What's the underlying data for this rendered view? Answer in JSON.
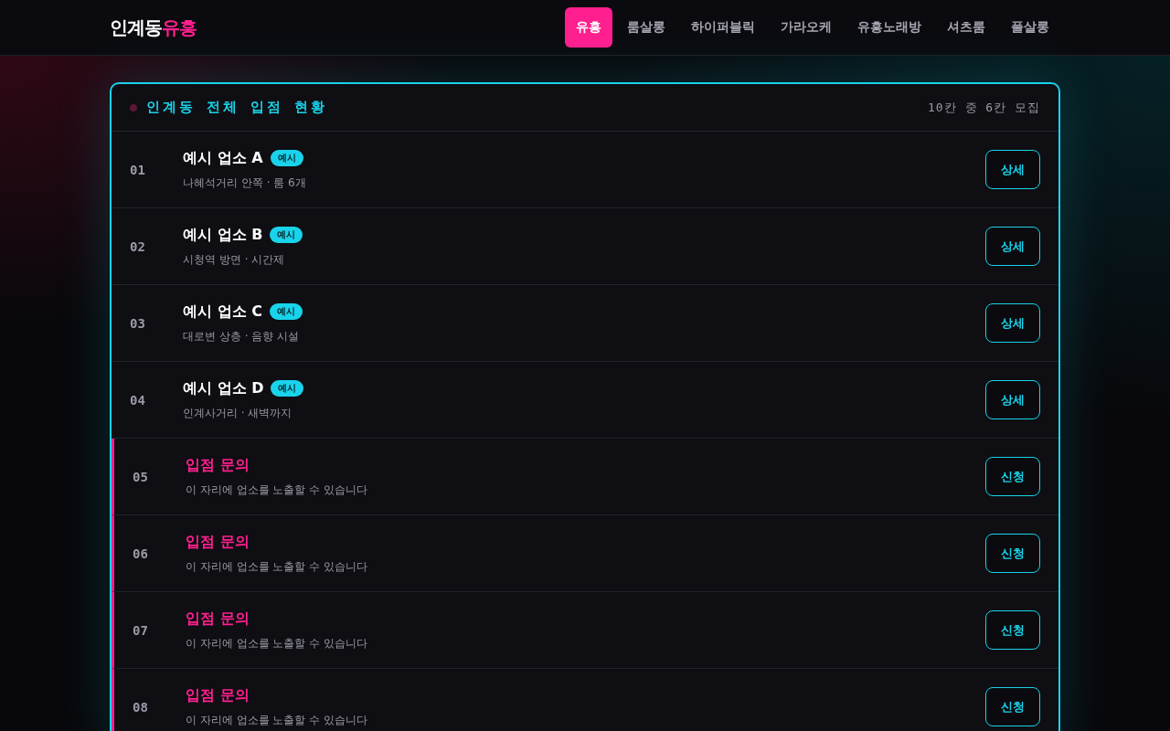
{
  "header": {
    "logo": [
      {
        "text": "인계동",
        "kind": "plain"
      },
      {
        "text": "유흥",
        "kind": "accent"
      }
    ],
    "nav": [
      {
        "label": "유흥",
        "selected": true
      },
      {
        "label": "룸살롱",
        "selected": false
      },
      {
        "label": "하이퍼블릭",
        "selected": false
      },
      {
        "label": "가라오케",
        "selected": false
      },
      {
        "label": "유흥노래방",
        "selected": false
      },
      {
        "label": "셔츠룸",
        "selected": false
      },
      {
        "label": "풀살롱",
        "selected": false
      }
    ]
  },
  "panel": {
    "title": "인계동 전체 입점 현황",
    "summary": "10칸 중 6칸 모집",
    "rows": [
      {
        "kind": "listing",
        "number": "01",
        "name": "예시 업소 A",
        "badge": "예시",
        "detail": "나혜석거리 안쪽 · 룸 6개",
        "button": "상세"
      },
      {
        "kind": "listing",
        "number": "02",
        "name": "예시 업소 B",
        "badge": "예시",
        "detail": "시청역 방면 · 시간제",
        "button": "상세"
      },
      {
        "kind": "listing",
        "number": "03",
        "name": "예시 업소 C",
        "badge": "예시",
        "detail": "대로변 상층 · 음향 시설",
        "button": "상세"
      },
      {
        "kind": "listing",
        "number": "04",
        "name": "예시 업소 D",
        "badge": "예시",
        "detail": "인계사거리 · 새벽까지",
        "button": "상세"
      },
      {
        "kind": "vacancy",
        "number": "05",
        "name": "입점 문의",
        "detail": "이 자리에 업소를 노출할 수 있습니다",
        "button": "신청"
      },
      {
        "kind": "vacancy",
        "number": "06",
        "name": "입점 문의",
        "detail": "이 자리에 업소를 노출할 수 있습니다",
        "button": "신청"
      },
      {
        "kind": "vacancy",
        "number": "07",
        "name": "입점 문의",
        "detail": "이 자리에 업소를 노출할 수 있습니다",
        "button": "신청"
      },
      {
        "kind": "vacancy",
        "number": "08",
        "name": "입점 문의",
        "detail": "이 자리에 업소를 노출할 수 있습니다",
        "button": "신청"
      }
    ]
  }
}
